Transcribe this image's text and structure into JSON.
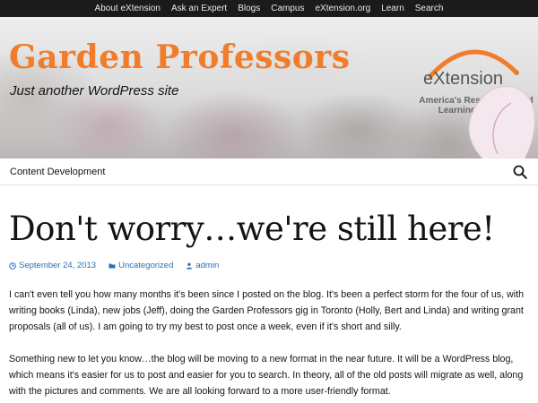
{
  "topbar": {
    "links": [
      "About eXtension",
      "Ask an Expert",
      "Blogs",
      "Campus",
      "eXtension.org",
      "Learn",
      "Search"
    ]
  },
  "header": {
    "site_title": "Garden Professors",
    "tagline": "Just another WordPress site",
    "logo": {
      "wordmark": "eXtension",
      "tag_line1": "America's Research-based",
      "tag_line2": "Learning Network"
    }
  },
  "nav": {
    "item": "Content Development",
    "search_icon": "search-icon"
  },
  "post": {
    "title": "Don't worry…we're still here!",
    "date": "September 24, 2013",
    "category": "Uncategorized",
    "author": "admin",
    "paragraphs": [
      "I can't even tell you how many months it's been since I posted on the blog. It's been a perfect storm for the four of us, with writing books (Linda), new jobs (Jeff), doing the Garden Professors gig in Toronto (Holly, Bert and Linda) and writing grant proposals (all of us). I am going to try my best to post once a week, even if it's short and silly.",
      "Something new to let you know…the blog will be moving to a new format in the near future. It will be a WordPress blog, which means it's easier for us to post and easier for you to search. In theory, all of the old posts will migrate as well, along with the pictures and comments. We are all looking forward to a more user-friendly format."
    ]
  },
  "colors": {
    "title_orange": "#f07c2c",
    "link_blue": "#2a6fb5",
    "topbar_bg": "#1b1b1b"
  }
}
